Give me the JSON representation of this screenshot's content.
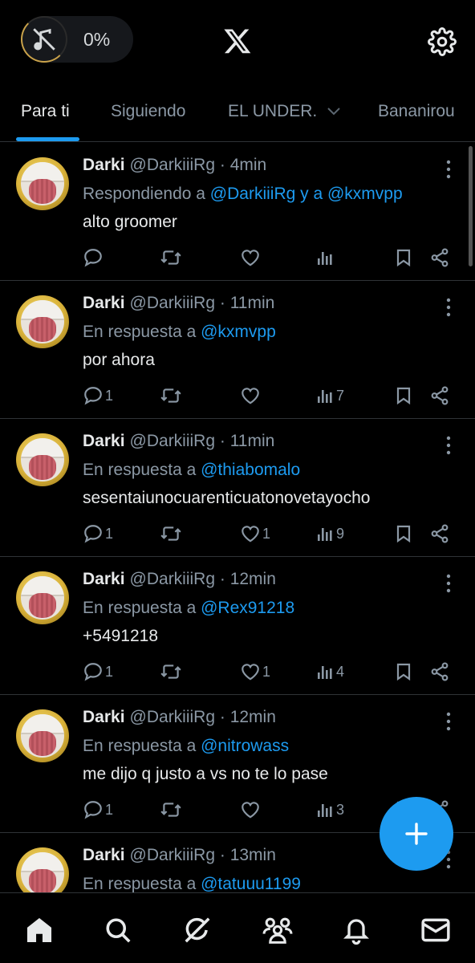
{
  "header": {
    "battery_saver_pct": "0%",
    "icons": {
      "left": "mute-icon",
      "center": "x-logo-icon",
      "right": "gear-icon"
    }
  },
  "tabs": [
    {
      "label": "Para ti",
      "active": true
    },
    {
      "label": "Siguiendo",
      "active": false
    },
    {
      "label": "EL UNDER.",
      "active": false
    },
    {
      "label": "Bananirou",
      "active": false
    }
  ],
  "posts": [
    {
      "name": "Darki",
      "handle": "@DarkiiiRg · 4min",
      "reply_prefix": "Respondiendo a ",
      "reply_mention": "@DarkiiiRg y a @kxmvpp",
      "text": "alto groomer",
      "replies": "",
      "likes": "",
      "views": ""
    },
    {
      "name": "Darki",
      "handle": "@DarkiiiRg · 11min",
      "reply_prefix": "En respuesta a ",
      "reply_mention": "@kxmvpp",
      "text": "por ahora",
      "replies": "1",
      "likes": "",
      "views": "7"
    },
    {
      "name": "Darki",
      "handle": "@DarkiiiRg · 11min",
      "reply_prefix": "En respuesta a ",
      "reply_mention": "@thiabomalo",
      "text": "sesentaiunocuarenticuatonovetayocho",
      "replies": "1",
      "likes": "1",
      "views": "9"
    },
    {
      "name": "Darki",
      "handle": "@DarkiiiRg · 12min",
      "reply_prefix": "En respuesta a ",
      "reply_mention": "@Rex91218",
      "text": "+5491218",
      "replies": "1",
      "likes": "1",
      "views": "4"
    },
    {
      "name": "Darki",
      "handle": "@DarkiiiRg · 12min",
      "reply_prefix": "En respuesta a ",
      "reply_mention": "@nitrowass",
      "text": "me dijo q justo a vs no te lo pase",
      "replies": "1",
      "likes": "",
      "views": "3"
    },
    {
      "name": "Darki",
      "handle": "@DarkiiiRg · 13min",
      "reply_prefix": "En respuesta a ",
      "reply_mention": "@tatuuu1199",
      "text": "",
      "replies": "",
      "likes": "",
      "views": ""
    }
  ],
  "fab": {
    "icon": "plus-icon"
  },
  "bottom_nav": [
    "home-icon",
    "search-icon",
    "grok-icon",
    "communities-icon",
    "notifications-icon",
    "messages-icon"
  ],
  "colors": {
    "accent": "#1d9bf0",
    "background": "#000000",
    "muted": "#8b98a5"
  }
}
